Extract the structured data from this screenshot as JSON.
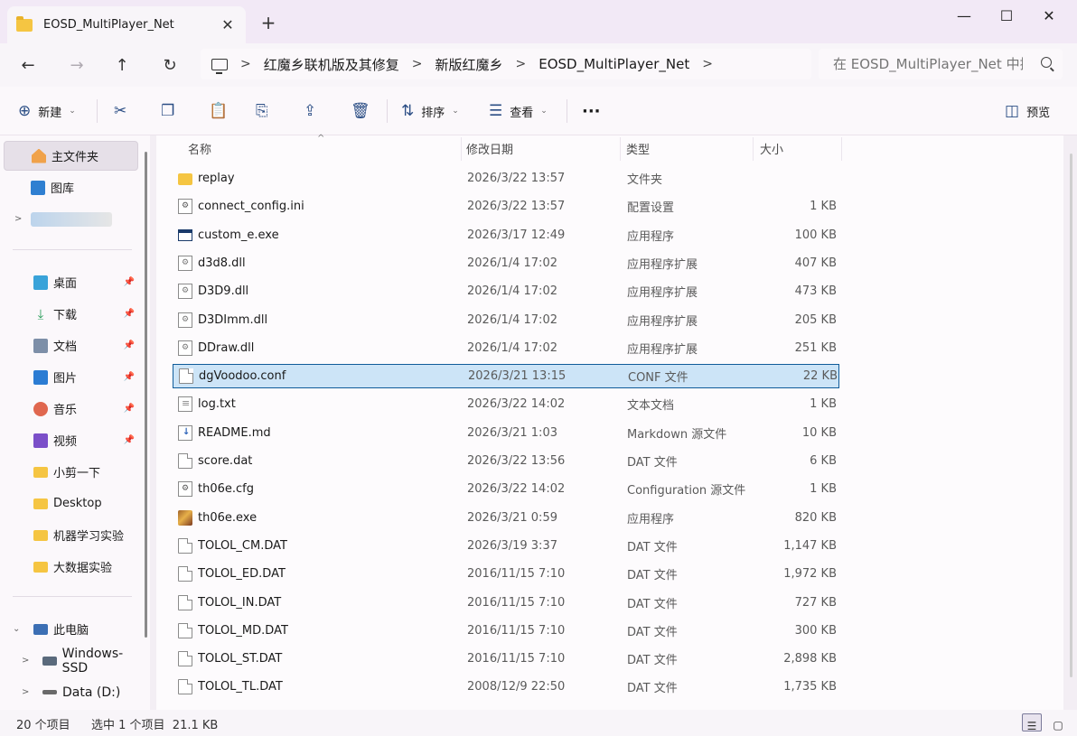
{
  "window": {
    "tab_title": "EOSD_MultiPlayer_Net",
    "tab_close": "✕",
    "new_tab": "+",
    "minimize": "—",
    "maximize": "☐",
    "close": "✕"
  },
  "nav": {
    "back": "←",
    "forward": "→",
    "up": "↑",
    "refresh": "↻",
    "breadcrumbs": [
      "红魔乡联机版及其修复",
      "新版红魔乡",
      "EOSD_MultiPlayer_Net"
    ],
    "sep": ">",
    "search_placeholder": "在 EOSD_MultiPlayer_Net 中搜索"
  },
  "toolbar": {
    "new_label": "新建",
    "sort_label": "排序",
    "view_label": "查看",
    "more_label": "···",
    "preview_label": "预览",
    "chevron": "⌄"
  },
  "sidebar": {
    "home": "主文件夹",
    "gallery": "图库",
    "quick": [
      {
        "label": "桌面",
        "pinned": true
      },
      {
        "label": "下载",
        "pinned": true
      },
      {
        "label": "文档",
        "pinned": true
      },
      {
        "label": "图片",
        "pinned": true
      },
      {
        "label": "音乐",
        "pinned": true
      },
      {
        "label": "视频",
        "pinned": true
      },
      {
        "label": "小剪一下",
        "pinned": false
      },
      {
        "label": "Desktop",
        "pinned": false
      },
      {
        "label": "机器学习实验",
        "pinned": false
      },
      {
        "label": "大数据实验",
        "pinned": false
      }
    ],
    "this_pc": "此电脑",
    "drives": [
      "Windows-SSD",
      "Data (D:)"
    ],
    "pin_glyph": "📌",
    "expand_right": ">",
    "expand_down": "⌄"
  },
  "columns": {
    "name": "名称",
    "modified": "修改日期",
    "type": "类型",
    "size": "大小",
    "sort_glyph": "^"
  },
  "files": [
    {
      "name": "replay",
      "date": "2026/3/22 13:57",
      "type": "文件夹",
      "size": "",
      "icon": "folder"
    },
    {
      "name": "connect_config.ini",
      "date": "2026/3/22 13:57",
      "type": "配置设置",
      "size": "1 KB",
      "icon": "gear"
    },
    {
      "name": "custom_e.exe",
      "date": "2026/3/17 12:49",
      "type": "应用程序",
      "size": "100 KB",
      "icon": "exe"
    },
    {
      "name": "d3d8.dll",
      "date": "2026/1/4 17:02",
      "type": "应用程序扩展",
      "size": "407 KB",
      "icon": "dll"
    },
    {
      "name": "D3D9.dll",
      "date": "2026/1/4 17:02",
      "type": "应用程序扩展",
      "size": "473 KB",
      "icon": "dll"
    },
    {
      "name": "D3DImm.dll",
      "date": "2026/1/4 17:02",
      "type": "应用程序扩展",
      "size": "205 KB",
      "icon": "dll"
    },
    {
      "name": "DDraw.dll",
      "date": "2026/1/4 17:02",
      "type": "应用程序扩展",
      "size": "251 KB",
      "icon": "dll"
    },
    {
      "name": "dgVoodoo.conf",
      "date": "2026/3/21 13:15",
      "type": "CONF 文件",
      "size": "22 KB",
      "icon": "doc",
      "selected": true
    },
    {
      "name": "log.txt",
      "date": "2026/3/22 14:02",
      "type": "文本文档",
      "size": "1 KB",
      "icon": "txt"
    },
    {
      "name": "README.md",
      "date": "2026/3/21 1:03",
      "type": "Markdown 源文件",
      "size": "10 KB",
      "icon": "md"
    },
    {
      "name": "score.dat",
      "date": "2026/3/22 13:56",
      "type": "DAT 文件",
      "size": "6 KB",
      "icon": "doc"
    },
    {
      "name": "th06e.cfg",
      "date": "2026/3/22 14:02",
      "type": "Configuration 源文件",
      "size": "1 KB",
      "icon": "gear"
    },
    {
      "name": "th06e.exe",
      "date": "2026/3/21 0:59",
      "type": "应用程序",
      "size": "820 KB",
      "icon": "game"
    },
    {
      "name": "TOLOL_CM.DAT",
      "date": "2026/3/19 3:37",
      "type": "DAT 文件",
      "size": "1,147 KB",
      "icon": "doc"
    },
    {
      "name": "TOLOL_ED.DAT",
      "date": "2016/11/15 7:10",
      "type": "DAT 文件",
      "size": "1,972 KB",
      "icon": "doc"
    },
    {
      "name": "TOLOL_IN.DAT",
      "date": "2016/11/15 7:10",
      "type": "DAT 文件",
      "size": "727 KB",
      "icon": "doc"
    },
    {
      "name": "TOLOL_MD.DAT",
      "date": "2016/11/15 7:10",
      "type": "DAT 文件",
      "size": "300 KB",
      "icon": "doc"
    },
    {
      "name": "TOLOL_ST.DAT",
      "date": "2016/11/15 7:10",
      "type": "DAT 文件",
      "size": "2,898 KB",
      "icon": "doc"
    },
    {
      "name": "TOLOL_TL.DAT",
      "date": "2008/12/9 22:50",
      "type": "DAT 文件",
      "size": "1,735 KB",
      "icon": "doc"
    }
  ],
  "status": {
    "count": "20 个项目",
    "selection": "选中 1 个项目  21.1 KB"
  },
  "colors": {
    "accent": "#0f5c9a",
    "selected_bg": "#cce4f7",
    "folder": "#f5c542"
  }
}
